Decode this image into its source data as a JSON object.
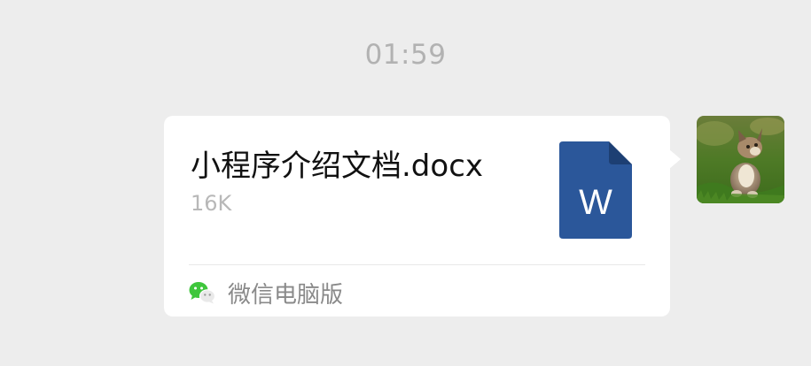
{
  "chat": {
    "timestamp": "01:59"
  },
  "message": {
    "file_name": "小程序介绍文档.docx",
    "file_size": "16K",
    "file_icon": "word-document-icon",
    "file_icon_letter": "W",
    "source_icon": "wechat-icon",
    "source_label": "微信电脑版"
  },
  "sender": {
    "avatar": "kitten-avatar"
  },
  "colors": {
    "background": "#ededed",
    "bubble": "#ffffff",
    "word_blue": "#2b579a",
    "wechat_green": "#3fc63c",
    "secondary_text": "#b2b2b2"
  }
}
